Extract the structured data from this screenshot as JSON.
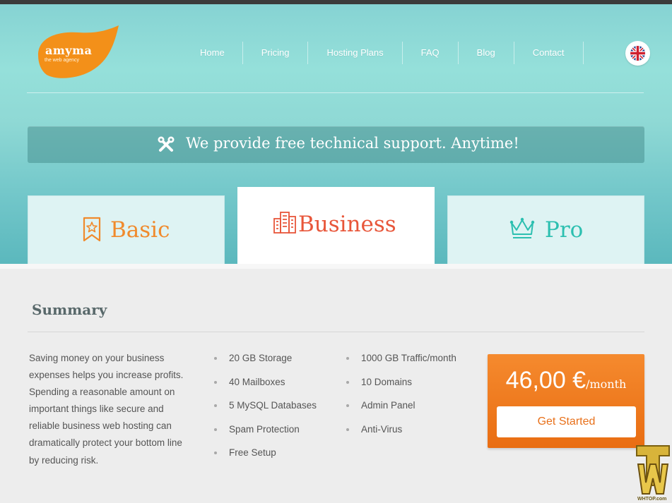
{
  "brand": {
    "name": "amyma",
    "tagline": "the web agency",
    "color": "#f39019"
  },
  "nav": {
    "items": [
      {
        "label": "Home"
      },
      {
        "label": "Pricing"
      },
      {
        "label": "Hosting Plans"
      },
      {
        "label": "FAQ"
      },
      {
        "label": "Blog"
      },
      {
        "label": "Contact"
      }
    ],
    "language_icon": "uk-flag-icon"
  },
  "banner": {
    "icon": "tools-icon",
    "text": "We provide free technical support. Anytime!"
  },
  "plans": [
    {
      "label": "Basic",
      "icon": "bookmark-star-icon",
      "color": "#f08a2c",
      "selected": false
    },
    {
      "label": "Business",
      "icon": "building-icon",
      "color": "#e8563a",
      "selected": true
    },
    {
      "label": "Pro",
      "icon": "crown-icon",
      "color": "#2cbfb0",
      "selected": false
    }
  ],
  "summary": {
    "title": "Summary",
    "description": "Saving money on your business expenses helps you increase profits. Spending a reasonable amount on important things like secure and reliable business web hosting can dramatically protect your bottom line by reducing risk.",
    "features_col1": [
      "20 GB Storage",
      "40 Mailboxes",
      "5 MySQL Databases",
      "Spam Protection",
      "Free Setup"
    ],
    "features_col2": [
      "1000 GB Traffic/month",
      "10 Domains",
      "Admin Panel",
      "Anti-Virus"
    ]
  },
  "price": {
    "amount": "46,00 €",
    "unit": "/month",
    "cta": "Get Started",
    "color": "#ee7a20"
  },
  "watermark": {
    "text": "WHTOP.com"
  }
}
